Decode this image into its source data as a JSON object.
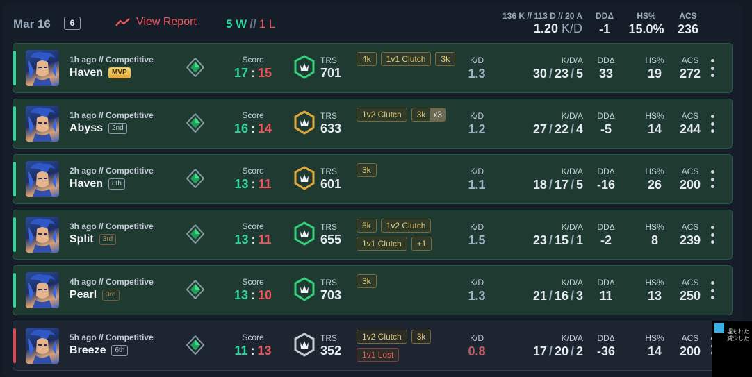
{
  "header": {
    "date": "Mar 16",
    "match_count": "6",
    "view_report_label": "View Report",
    "wins": "5 W",
    "wl_separator": "//",
    "losses": "1 L",
    "kda_summary": "136 K // 113 D // 20 A",
    "kd_value": "1.20",
    "kd_unit": "K/D",
    "dd_label": "DDΔ",
    "dd_value": "-1",
    "hs_label": "HS%",
    "hs_value": "15.0%",
    "acs_label": "ACS",
    "acs_value": "236"
  },
  "labels": {
    "score": "Score",
    "trs": "TRS",
    "kd": "K/D",
    "kda": "K/D/A",
    "dd": "DDΔ",
    "hs": "HS%",
    "acs": "ACS",
    "score_sep": ":",
    "kda_sep": "/"
  },
  "colors": {
    "win": "#2fd69c",
    "loss": "#f0545c",
    "trs_green": "#35d07a",
    "trs_gold": "#e0a93a",
    "trs_grey": "#c8ccd2"
  },
  "matches": [
    {
      "when": "1h ago // Competitive",
      "map": "Haven",
      "placement": "MVP",
      "placement_style": "mvp",
      "score_team": "17",
      "score_enemy": "15",
      "trs_icon": "trs-green-icon",
      "trs": "701",
      "tags": [
        {
          "label": "4k"
        },
        {
          "label": "1v1 Clutch"
        },
        {
          "label": "3k"
        }
      ],
      "kd": "1.3",
      "k": "30",
      "d": "23",
      "a": "5",
      "dd": "33",
      "hs": "19",
      "acs": "272",
      "result": "win"
    },
    {
      "when": "1h ago // Competitive",
      "map": "Abyss",
      "placement": "2nd",
      "placement_style": "plain",
      "score_team": "16",
      "score_enemy": "14",
      "trs_icon": "trs-gold-icon",
      "trs": "633",
      "tags": [
        {
          "label": "1v2 Clutch"
        },
        {
          "label": "3k",
          "mult": "x3"
        }
      ],
      "kd": "1.2",
      "k": "27",
      "d": "22",
      "a": "4",
      "dd": "-5",
      "hs": "14",
      "acs": "244",
      "result": "win"
    },
    {
      "when": "2h ago // Competitive",
      "map": "Haven",
      "placement": "8th",
      "placement_style": "plain",
      "score_team": "13",
      "score_enemy": "11",
      "trs_icon": "trs-gold-icon",
      "trs": "601",
      "tags": [
        {
          "label": "3k"
        }
      ],
      "kd": "1.1",
      "k": "18",
      "d": "17",
      "a": "5",
      "dd": "-16",
      "hs": "26",
      "acs": "200",
      "result": "win"
    },
    {
      "when": "3h ago // Competitive",
      "map": "Split",
      "placement": "3rd",
      "placement_style": "bronze",
      "score_team": "13",
      "score_enemy": "11",
      "trs_icon": "trs-green-icon",
      "trs": "655",
      "tags": [
        {
          "label": "5k"
        },
        {
          "label": "1v2 Clutch"
        },
        {
          "label": "1v1 Clutch"
        },
        {
          "label": "+1"
        }
      ],
      "kd": "1.5",
      "k": "23",
      "d": "15",
      "a": "1",
      "dd": "-2",
      "hs": "8",
      "acs": "239",
      "result": "win"
    },
    {
      "when": "4h ago // Competitive",
      "map": "Pearl",
      "placement": "3rd",
      "placement_style": "bronze",
      "score_team": "13",
      "score_enemy": "10",
      "trs_icon": "trs-green-icon",
      "trs": "703",
      "tags": [
        {
          "label": "3k"
        }
      ],
      "kd": "1.3",
      "k": "21",
      "d": "16",
      "a": "3",
      "dd": "11",
      "hs": "13",
      "acs": "250",
      "result": "win"
    },
    {
      "when": "5h ago // Competitive",
      "map": "Breeze",
      "placement": "6th",
      "placement_style": "plain",
      "score_team": "11",
      "score_enemy": "13",
      "trs_icon": "trs-grey-icon",
      "trs": "352",
      "tags": [
        {
          "label": "1v2 Clutch"
        },
        {
          "label": "3k"
        },
        {
          "label": "1v1 Lost",
          "style": "lost"
        }
      ],
      "kd": "0.8",
      "k": "17",
      "d": "20",
      "a": "2",
      "dd": "-36",
      "hs": "14",
      "acs": "200",
      "result": "loss"
    }
  ],
  "ad": {
    "text_line1": "埋もれた",
    "text_line2": "減少した"
  }
}
